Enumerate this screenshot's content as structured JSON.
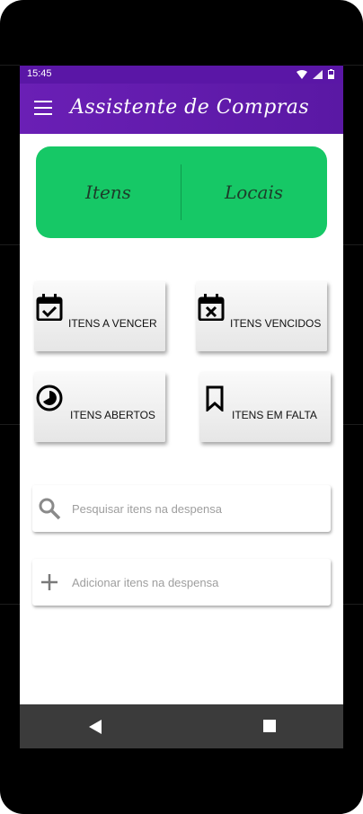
{
  "status_bar": {
    "time": "15:45",
    "icons": [
      "wifi-icon",
      "signal-icon",
      "battery-icon"
    ]
  },
  "app_bar": {
    "title": "Assistente de Compras",
    "menu_icon": "menu-icon"
  },
  "segment": {
    "left_label": "Itens",
    "right_label": "Locais",
    "color": "#16c866"
  },
  "tiles": [
    {
      "label": "ITENS A VENCER",
      "icon": "calendar-check-icon"
    },
    {
      "label": "ITENS VENCIDOS",
      "icon": "calendar-x-icon"
    },
    {
      "label": "ITENS ABERTOS",
      "icon": "pie-clock-icon"
    },
    {
      "label": "ITENS EM FALTA",
      "icon": "bookmark-icon"
    }
  ],
  "search": {
    "placeholder": "Pesquisar itens na despensa",
    "icon": "search-icon"
  },
  "add": {
    "placeholder": "Adicionar itens na despensa",
    "icon": "plus-icon"
  },
  "colors": {
    "appbar": "#6a1fb5",
    "statusbar": "#5a16a6",
    "navbar": "#3b3b3b"
  }
}
